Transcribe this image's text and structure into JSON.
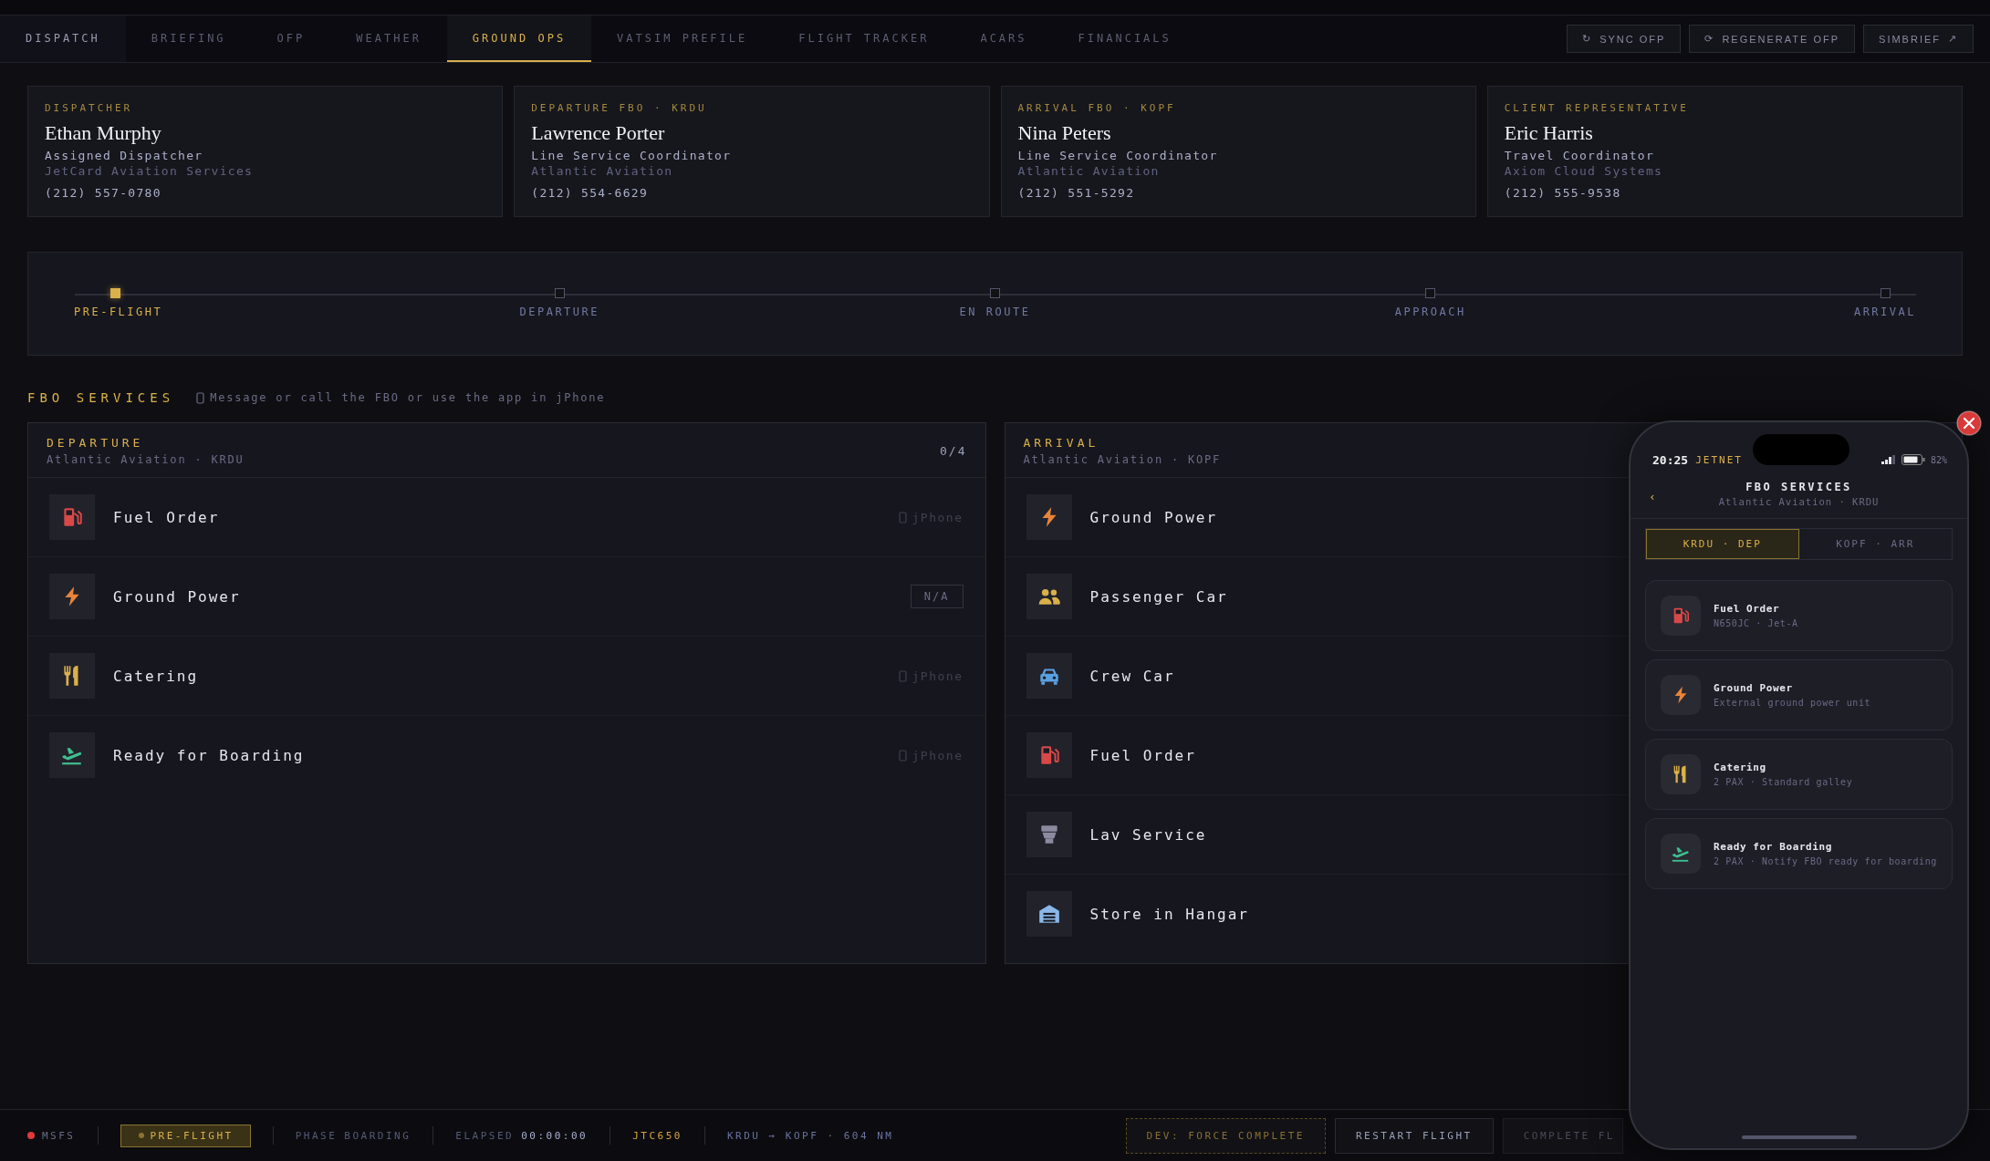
{
  "nav": {
    "tabs": [
      {
        "label": "DISPATCH",
        "selected": false
      },
      {
        "label": "BRIEFING",
        "selected": false
      },
      {
        "label": "OFP",
        "selected": false
      },
      {
        "label": "WEATHER",
        "selected": false
      },
      {
        "label": "GROUND OPS",
        "selected": true
      },
      {
        "label": "VATSIM PREFILE",
        "selected": false
      },
      {
        "label": "FLIGHT TRACKER",
        "selected": false
      },
      {
        "label": "ACARS",
        "selected": false
      },
      {
        "label": "FINANCIALS",
        "selected": false
      }
    ],
    "actions": [
      {
        "icon": "↻",
        "label": "SYNC OFP"
      },
      {
        "icon": "⟳",
        "label": "REGENERATE OFP"
      },
      {
        "label": "SIMBRIEF",
        "trail": "↗"
      }
    ]
  },
  "contacts": [
    {
      "role": "DISPATCHER",
      "name": "Ethan Murphy",
      "title": "Assigned Dispatcher",
      "company": "JetCard Aviation Services",
      "phone": "(212) 557-0780"
    },
    {
      "role": "DEPARTURE FBO · KRDU",
      "name": "Lawrence Porter",
      "title": "Line Service Coordinator",
      "company": "Atlantic Aviation",
      "phone": "(212) 554-6629"
    },
    {
      "role": "ARRIVAL FBO · KOPF",
      "name": "Nina Peters",
      "title": "Line Service Coordinator",
      "company": "Atlantic Aviation",
      "phone": "(212) 551-5292"
    },
    {
      "role": "CLIENT REPRESENTATIVE",
      "name": "Eric Harris",
      "title": "Travel Coordinator",
      "company": "Axiom Cloud Systems",
      "phone": "(212) 555-9538"
    }
  ],
  "timeline": [
    {
      "label": "PRE-FLIGHT",
      "selected": true
    },
    {
      "label": "DEPARTURE",
      "selected": false
    },
    {
      "label": "EN ROUTE",
      "selected": false
    },
    {
      "label": "APPROACH",
      "selected": false
    },
    {
      "label": "ARRIVAL",
      "selected": false
    }
  ],
  "fbo": {
    "title": "FBO SERVICES",
    "hint": "Message or call the FBO or use the app in jPhone"
  },
  "panels": [
    {
      "title": "DEPARTURE",
      "subtitle": "Atlantic Aviation · KRDU",
      "count": "0/4",
      "services": [
        {
          "name": "Fuel Order",
          "kind": "fuel",
          "status": {
            "kind": "app",
            "label": "jPhone"
          }
        },
        {
          "name": "Ground Power",
          "kind": "power",
          "status": {
            "kind": "badge",
            "label": "N/A"
          }
        },
        {
          "name": "Catering",
          "kind": "catering",
          "status": {
            "kind": "app",
            "label": "jPhone"
          }
        },
        {
          "name": "Ready for Boarding",
          "kind": "boarding",
          "status": {
            "kind": "app",
            "label": "jPhone"
          }
        }
      ]
    },
    {
      "title": "ARRIVAL",
      "subtitle": "Atlantic Aviation · KOPF",
      "services": [
        {
          "name": "Ground Power",
          "kind": "power"
        },
        {
          "name": "Passenger Car",
          "kind": "passengers"
        },
        {
          "name": "Crew Car",
          "kind": "car"
        },
        {
          "name": "Fuel Order",
          "kind": "fuel"
        },
        {
          "name": "Lav Service",
          "kind": "lav"
        },
        {
          "name": "Store in Hangar",
          "kind": "hangar"
        }
      ]
    }
  ],
  "phone": {
    "time": "20:25",
    "carrier": "JETNET",
    "battery": "82%",
    "back": "‹",
    "title": "FBO SERVICES",
    "subtitle": "Atlantic Aviation · KRDU",
    "tabs": [
      {
        "label": "KRDU · DEP",
        "selected": true
      },
      {
        "label": "KOPF · ARR",
        "selected": false
      }
    ],
    "items": [
      {
        "name": "Fuel Order",
        "detail": "N650JC · Jet-A",
        "kind": "fuel"
      },
      {
        "name": "Ground Power",
        "detail": "External ground power unit",
        "kind": "power"
      },
      {
        "name": "Catering",
        "detail": "2 PAX · Standard galley",
        "kind": "catering"
      },
      {
        "name": "Ready for Boarding",
        "detail": "2 PAX · Notify FBO ready for boarding",
        "kind": "boarding"
      }
    ]
  },
  "status_bar": {
    "sim": "MSFS",
    "phase_badge": "PRE-FLIGHT",
    "phase_label": "PHASE",
    "phase_value": "BOARDING",
    "elapsed_label": "ELAPSED",
    "elapsed_value": "00:00:00",
    "callsign": "JTC650",
    "route": "KRDU → KOPF · 604 NM",
    "buttons": [
      {
        "label": "DEV: FORCE COMPLETE",
        "kind": "dev"
      },
      {
        "label": "RESTART FLIGHT",
        "kind": "normal"
      },
      {
        "label": "COMPLETE FL",
        "kind": "disabled"
      }
    ]
  }
}
